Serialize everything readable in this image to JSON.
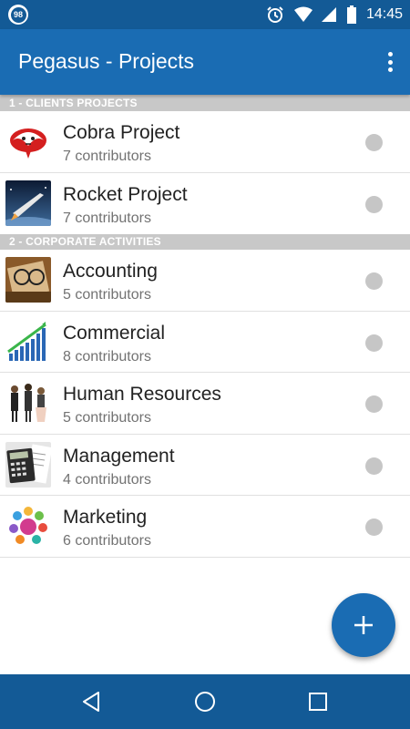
{
  "status_bar": {
    "badge": "98",
    "time": "14:45",
    "icons": [
      "alarm-icon",
      "wifi-icon",
      "cell-signal-icon",
      "battery-icon"
    ]
  },
  "app_bar": {
    "title": "Pegasus - Projects",
    "menu_icon": "overflow-menu-icon"
  },
  "sections": [
    {
      "header": "1 - CLIENTS PROJECTS",
      "items": [
        {
          "title": "Cobra Project",
          "subtitle": "7 contributors",
          "icon": "cobra-logo"
        },
        {
          "title": "Rocket Project",
          "subtitle": "7 contributors",
          "icon": "rocket-image"
        }
      ]
    },
    {
      "header": "2 - CORPORATE ACTIVITIES",
      "items": [
        {
          "title": "Accounting",
          "subtitle": "5 contributors",
          "icon": "glasses-documents-image"
        },
        {
          "title": "Commercial",
          "subtitle": "8 contributors",
          "icon": "growth-chart-image"
        },
        {
          "title": "Human Resources",
          "subtitle": "5 contributors",
          "icon": "business-people-image"
        },
        {
          "title": "Management",
          "subtitle": "4 contributors",
          "icon": "calculator-image"
        },
        {
          "title": "Marketing",
          "subtitle": "6 contributors",
          "icon": "marketing-icons-image"
        }
      ]
    }
  ],
  "fab": {
    "icon": "plus-icon"
  },
  "nav_bar": {
    "icons": [
      "back-icon",
      "home-icon",
      "recents-icon"
    ]
  },
  "colors": {
    "primary": "#1a6cb3",
    "primary_dark": "#135a96",
    "section_header": "#c8c8c8",
    "status_dot": "#c6c6c6"
  }
}
